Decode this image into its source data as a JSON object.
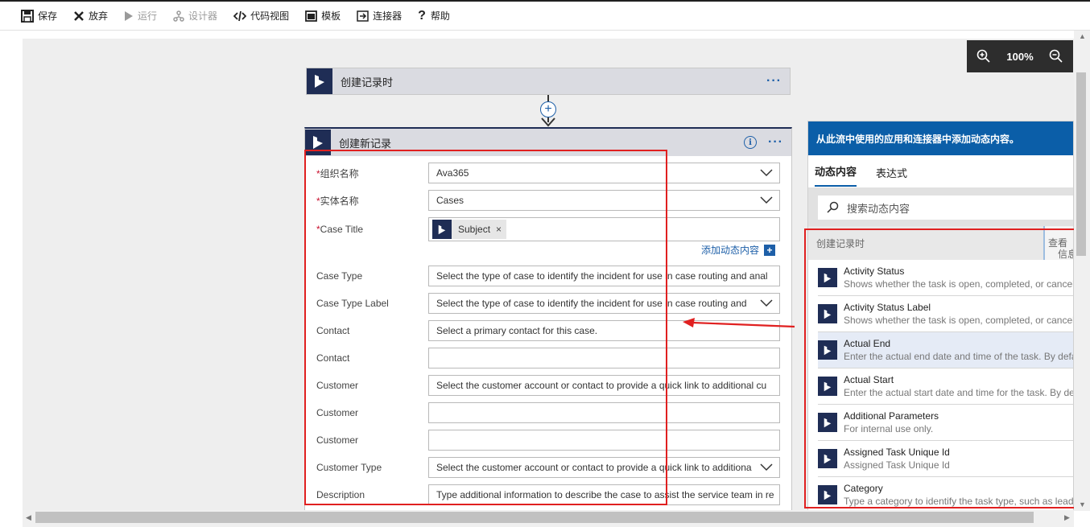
{
  "toolbar": {
    "save": "保存",
    "discard": "放弃",
    "run": "运行",
    "designer": "设计器",
    "code_view": "代码视图",
    "templates": "模板",
    "connectors": "连接器",
    "help": "帮助"
  },
  "zoom": {
    "level": "100%"
  },
  "trigger": {
    "title": "创建记录时",
    "more": "···"
  },
  "action": {
    "title": "创建新记录",
    "more": "···",
    "info": "i",
    "add_dynamic": "添加动态内容",
    "fields": [
      {
        "required": "*",
        "label": "组织名称",
        "value": "Ava365",
        "dropdown": true
      },
      {
        "required": "*",
        "label": "实体名称",
        "value": "Cases",
        "dropdown": true
      },
      {
        "required": "*",
        "label": "Case Title",
        "token": "Subject",
        "token_remove": "×"
      },
      {
        "required": "",
        "label": "Case Type",
        "value": "Select the type of case to identify the incident for use in case routing and anal",
        "dropdown": false
      },
      {
        "required": "",
        "label": "Case Type Label",
        "value": "Select the type of case to identify the incident for use in case routing and",
        "dropdown": true
      },
      {
        "required": "",
        "label": "Contact",
        "value": "Select a primary contact for this case.",
        "dropdown": false
      },
      {
        "required": "",
        "label": "Contact",
        "value": "",
        "dropdown": false
      },
      {
        "required": "",
        "label": "Customer",
        "value": "Select the customer account or contact to provide a quick link to additional cu",
        "dropdown": false
      },
      {
        "required": "",
        "label": "Customer",
        "value": "",
        "dropdown": false
      },
      {
        "required": "",
        "label": "Customer",
        "value": "",
        "dropdown": false
      },
      {
        "required": "",
        "label": "Customer Type",
        "value": "Select the customer account or contact to provide a quick link to additiona",
        "dropdown": true
      },
      {
        "required": "",
        "label": "Description",
        "value": "Type additional information to describe the case to assist the service team in re",
        "dropdown": false
      }
    ]
  },
  "dynamic_panel": {
    "header": "从此流中使用的应用和连接器中添加动态内容。",
    "tabs": [
      "动态内容",
      "表达式"
    ],
    "search_placeholder": "搜索动态内容",
    "section": "创建记录时",
    "see_more": [
      "查看",
      "信息"
    ],
    "items": [
      {
        "title": "Activity Status",
        "desc": "Shows whether the task is open, completed, or canceled."
      },
      {
        "title": "Activity Status Label",
        "desc": "Shows whether the task is open, completed, or canceled."
      },
      {
        "title": "Actual End",
        "desc": "Enter the actual end date and time of the task. By default"
      },
      {
        "title": "Actual Start",
        "desc": "Enter the actual start date and time for the task. By default"
      },
      {
        "title": "Additional Parameters",
        "desc": "For internal use only."
      },
      {
        "title": "Assigned Task Unique Id",
        "desc": "Assigned Task Unique Id"
      },
      {
        "title": "Category",
        "desc": "Type a category to identify the task type, such as lead"
      }
    ]
  },
  "colors": {
    "accent": "#0b5ea8",
    "dynamics_logo": "#1f2d55",
    "highlight_box": "#e02020"
  }
}
